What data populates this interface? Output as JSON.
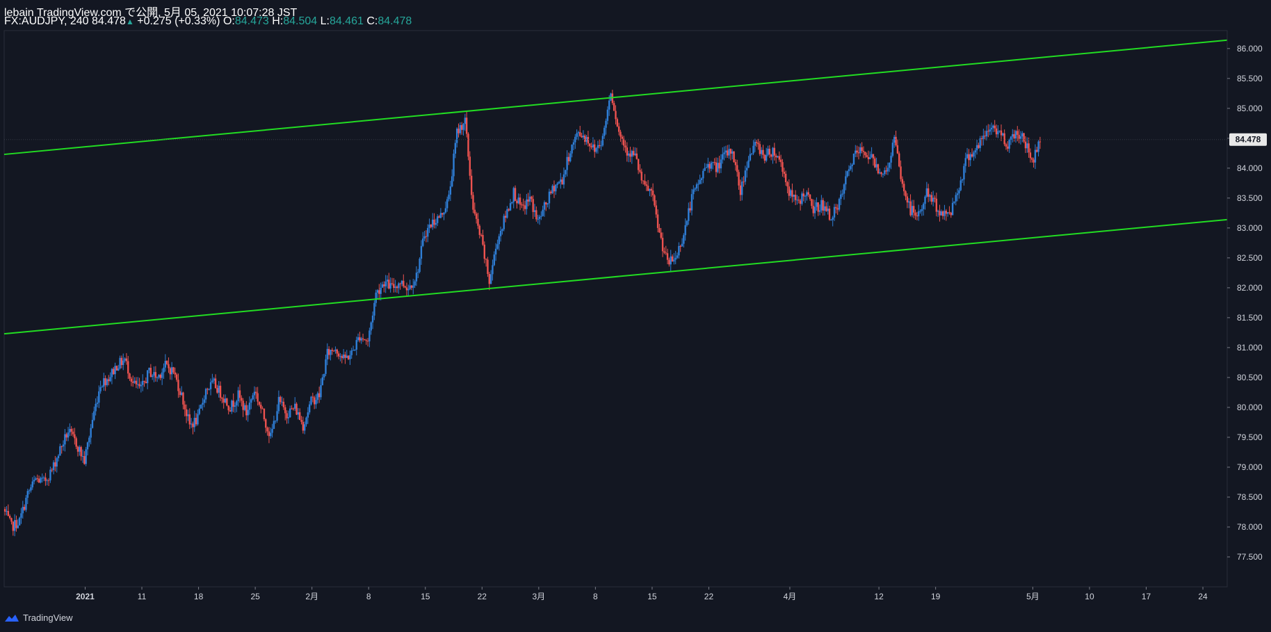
{
  "header": {
    "publish_line": "lebain TradingView.com で公開, 5月 05, 2021 10:07:28 JST",
    "symbol": "FX:AUDJPY, 240",
    "last": "84.478",
    "change": "+0.275 (+0.33%)",
    "o_label": "O:",
    "o_value": "84.473",
    "h_label": "H:",
    "h_value": "84.504",
    "l_label": "L:",
    "l_value": "84.461",
    "c_label": "C:",
    "c_value": "84.478"
  },
  "footer": {
    "brand": "TradingView",
    "logo_icon": "tradingview-logo-icon"
  },
  "colors": {
    "background": "#131722",
    "up": "#2f7fd8",
    "down": "#ef5350",
    "channel": "#22dd22",
    "price_badge": "#e8e8e8"
  },
  "chart_data": {
    "type": "candlestick",
    "symbol": "AUDJPY",
    "interval": "240",
    "ylim": [
      77.0,
      86.3
    ],
    "y_ticks": [
      "86.000",
      "85.500",
      "85.000",
      "84.500",
      "84.000",
      "83.500",
      "83.000",
      "82.500",
      "82.000",
      "81.500",
      "81.000",
      "80.500",
      "80.000",
      "79.500",
      "79.000",
      "78.500",
      "78.000",
      "77.500"
    ],
    "current_price": "84.478",
    "x_ticks": [
      {
        "label": "2021",
        "day": 3
      },
      {
        "label": "11",
        "day": 10
      },
      {
        "label": "18",
        "day": 17
      },
      {
        "label": "25",
        "day": 24
      },
      {
        "label": "2月",
        "day": 31
      },
      {
        "label": "8",
        "day": 38
      },
      {
        "label": "15",
        "day": 45
      },
      {
        "label": "22",
        "day": 52
      },
      {
        "label": "3月",
        "day": 59
      },
      {
        "label": "8",
        "day": 66
      },
      {
        "label": "15",
        "day": 73
      },
      {
        "label": "22",
        "day": 80
      },
      {
        "label": "4月",
        "day": 90
      },
      {
        "label": "12",
        "day": 101
      },
      {
        "label": "19",
        "day": 108
      },
      {
        "label": "5月",
        "day": 120
      },
      {
        "label": "10",
        "day": 127
      },
      {
        "label": "17",
        "day": 134
      },
      {
        "label": "24",
        "day": 141
      }
    ],
    "x_range_days": [
      -7,
      144
    ],
    "channel_lines": [
      {
        "name": "",
        "points": [
          [
            -7,
            84.23
          ],
          [
            144,
            86.14
          ]
        ]
      },
      {
        "name": "",
        "points": [
          [
            -7,
            81.23
          ],
          [
            144,
            83.14
          ]
        ]
      }
    ],
    "price_path": [
      [
        -7,
        78.3
      ],
      [
        -6,
        78.0
      ],
      [
        -5,
        78.1
      ],
      [
        -4,
        78.55
      ],
      [
        -3,
        78.8
      ],
      [
        -2,
        78.75
      ],
      [
        -1,
        78.95
      ],
      [
        0,
        79.3
      ],
      [
        1,
        79.6
      ],
      [
        2,
        79.4
      ],
      [
        3,
        79.1
      ],
      [
        4,
        79.8
      ],
      [
        5,
        80.4
      ],
      [
        6,
        80.5
      ],
      [
        7,
        80.7
      ],
      [
        8,
        80.8
      ],
      [
        9,
        80.4
      ],
      [
        10,
        80.3
      ],
      [
        11,
        80.6
      ],
      [
        12,
        80.5
      ],
      [
        13,
        80.7
      ],
      [
        14,
        80.6
      ],
      [
        15,
        80.2
      ],
      [
        16,
        79.7
      ],
      [
        17,
        79.8
      ],
      [
        18,
        80.3
      ],
      [
        19,
        80.4
      ],
      [
        20,
        80.2
      ],
      [
        21,
        80.0
      ],
      [
        22,
        80.2
      ],
      [
        23,
        79.9
      ],
      [
        24,
        80.3
      ],
      [
        25,
        79.9
      ],
      [
        26,
        79.5
      ],
      [
        27,
        80.1
      ],
      [
        28,
        79.9
      ],
      [
        29,
        80.0
      ],
      [
        30,
        79.7
      ],
      [
        31,
        80.1
      ],
      [
        32,
        80.2
      ],
      [
        33,
        80.9
      ],
      [
        34,
        81.0
      ],
      [
        35,
        80.8
      ],
      [
        36,
        80.9
      ],
      [
        37,
        81.2
      ],
      [
        38,
        81.1
      ],
      [
        39,
        81.9
      ],
      [
        40,
        82.1
      ],
      [
        41,
        82.0
      ],
      [
        42,
        82.1
      ],
      [
        43,
        82.0
      ],
      [
        44,
        82.2
      ],
      [
        45,
        82.9
      ],
      [
        46,
        83.1
      ],
      [
        47,
        83.2
      ],
      [
        48,
        83.5
      ],
      [
        49,
        84.6
      ],
      [
        50,
        84.8
      ],
      [
        51,
        83.3
      ],
      [
        52,
        82.8
      ],
      [
        53,
        82.1
      ],
      [
        54,
        82.8
      ],
      [
        55,
        83.2
      ],
      [
        56,
        83.6
      ],
      [
        57,
        83.3
      ],
      [
        58,
        83.5
      ],
      [
        59,
        83.1
      ],
      [
        60,
        83.4
      ],
      [
        61,
        83.7
      ],
      [
        62,
        83.8
      ],
      [
        63,
        84.3
      ],
      [
        64,
        84.6
      ],
      [
        65,
        84.5
      ],
      [
        66,
        84.3
      ],
      [
        67,
        84.5
      ],
      [
        68,
        85.3
      ],
      [
        69,
        84.6
      ],
      [
        70,
        84.3
      ],
      [
        71,
        84.2
      ],
      [
        72,
        83.7
      ],
      [
        73,
        83.6
      ],
      [
        74,
        82.9
      ],
      [
        75,
        82.4
      ],
      [
        76,
        82.5
      ],
      [
        77,
        82.9
      ],
      [
        78,
        83.5
      ],
      [
        79,
        83.8
      ],
      [
        80,
        84.1
      ],
      [
        81,
        84.0
      ],
      [
        82,
        84.2
      ],
      [
        83,
        84.3
      ],
      [
        84,
        83.6
      ],
      [
        85,
        84.2
      ],
      [
        86,
        84.4
      ],
      [
        87,
        84.2
      ],
      [
        88,
        84.3
      ],
      [
        89,
        84.1
      ],
      [
        90,
        83.6
      ],
      [
        91,
        83.4
      ],
      [
        92,
        83.6
      ],
      [
        93,
        83.3
      ],
      [
        94,
        83.4
      ],
      [
        95,
        83.2
      ],
      [
        96,
        83.3
      ],
      [
        97,
        83.8
      ],
      [
        98,
        84.2
      ],
      [
        99,
        84.3
      ],
      [
        100,
        84.2
      ],
      [
        101,
        84.0
      ],
      [
        102,
        83.9
      ],
      [
        103,
        84.5
      ],
      [
        104,
        83.7
      ],
      [
        105,
        83.3
      ],
      [
        106,
        83.2
      ],
      [
        107,
        83.6
      ],
      [
        108,
        83.4
      ],
      [
        109,
        83.2
      ],
      [
        110,
        83.3
      ],
      [
        111,
        83.7
      ],
      [
        112,
        84.2
      ],
      [
        113,
        84.3
      ],
      [
        114,
        84.5
      ],
      [
        115,
        84.7
      ],
      [
        116,
        84.6
      ],
      [
        117,
        84.4
      ],
      [
        118,
        84.6
      ],
      [
        119,
        84.5
      ],
      [
        120,
        84.1
      ],
      [
        121,
        84.48
      ]
    ]
  }
}
